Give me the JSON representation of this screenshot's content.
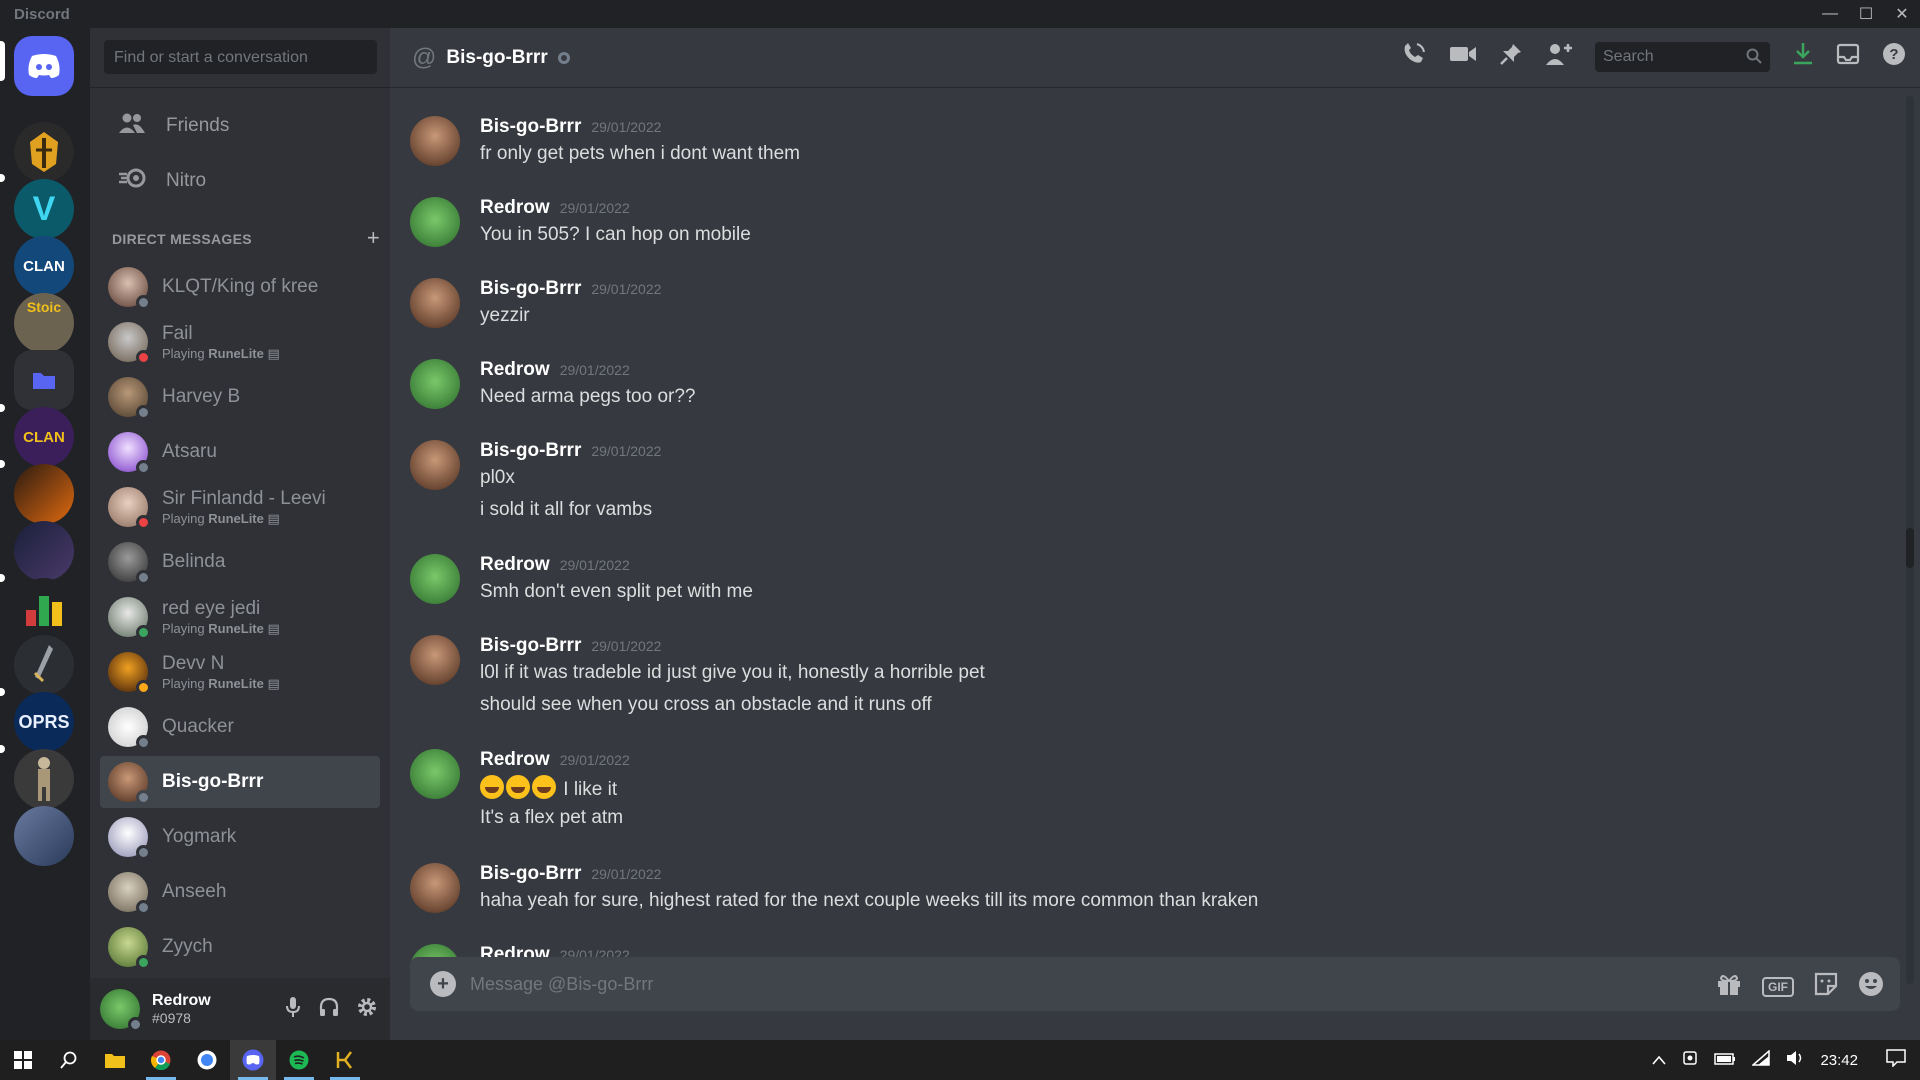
{
  "window": {
    "app_name": "Discord"
  },
  "colors": {
    "blurple": "#5865f2",
    "online": "#3ba55d",
    "dnd": "#ed4245",
    "idle": "#faa81a",
    "offline": "#747f8d"
  },
  "dm_sidebar": {
    "search_placeholder": "Find or start a conversation",
    "nav": {
      "friends": "Friends",
      "nitro": "Nitro"
    },
    "section_title": "DIRECT MESSAGES",
    "items": [
      {
        "name": "KLQT/King of kree",
        "sub": "",
        "status": "offline"
      },
      {
        "name": "Fail",
        "sub": "Playing ",
        "sub_game": "RuneLite",
        "status": "dnd"
      },
      {
        "name": "Harvey B",
        "sub": "",
        "status": "offline"
      },
      {
        "name": "Atsaru",
        "sub": "",
        "status": "offline"
      },
      {
        "name": "Sir Finlandd - Leevi",
        "sub": "Playing ",
        "sub_game": "RuneLite",
        "status": "dnd"
      },
      {
        "name": "Belinda",
        "sub": "",
        "status": "offline"
      },
      {
        "name": "red eye jedi",
        "sub": "Playing ",
        "sub_game": "RuneLite",
        "status": "online"
      },
      {
        "name": "Devv N",
        "sub": "Playing ",
        "sub_game": "RuneLite",
        "status": "idle"
      },
      {
        "name": "Quacker",
        "sub": "",
        "status": "offline"
      },
      {
        "name": "Bis-go-Brrr",
        "sub": "",
        "status": "offline"
      },
      {
        "name": "Yogmark",
        "sub": "",
        "status": "offline"
      },
      {
        "name": "Anseeh",
        "sub": "",
        "status": "offline"
      },
      {
        "name": "Zyych",
        "sub": "",
        "status": "online"
      }
    ]
  },
  "user_panel": {
    "username": "Redrow",
    "tag": "#0978"
  },
  "chat": {
    "title": "Bis-go-Brrr",
    "search_placeholder": "Search",
    "composer_placeholder": "Message @Bis-go-Brrr",
    "gif_label": "GIF",
    "messages": [
      {
        "author": "Bis-go-Brrr",
        "time": "29/01/2022",
        "lines": [
          "fr only get pets when i dont want them"
        ]
      },
      {
        "author": "Redrow",
        "time": "29/01/2022",
        "lines": [
          "You in 505? I can hop on mobile"
        ]
      },
      {
        "author": "Bis-go-Brrr",
        "time": "29/01/2022",
        "lines": [
          "yezzir"
        ]
      },
      {
        "author": "Redrow",
        "time": "29/01/2022",
        "lines": [
          "Need arma pegs too or??"
        ]
      },
      {
        "author": "Bis-go-Brrr",
        "time": "29/01/2022",
        "lines": [
          "pl0x",
          "i sold it all for vambs"
        ]
      },
      {
        "author": "Redrow",
        "time": "29/01/2022",
        "lines": [
          "Smh don't even split pet with me"
        ]
      },
      {
        "author": "Bis-go-Brrr",
        "time": "29/01/2022",
        "lines": [
          "l0l if it was tradeble id just give you it, honestly a horrible pet",
          "should see when you cross an obstacle and it runs off"
        ]
      },
      {
        "author": "Redrow",
        "time": "29/01/2022",
        "lines": [
          " I like it",
          "It's a flex pet atm"
        ]
      },
      {
        "author": "Bis-go-Brrr",
        "time": "29/01/2022",
        "lines": [
          "haha yeah for sure, highest rated for the next couple weeks till its more common than kraken"
        ]
      },
      {
        "author": "Redrow",
        "time": "29/01/2022",
        "lines": []
      }
    ]
  },
  "guilds": [
    {
      "label": "",
      "kind": "home"
    },
    {
      "label": "",
      "kind": "helmet"
    },
    {
      "label": "V",
      "kind": "v"
    },
    {
      "label": "CLAN",
      "kind": "clan"
    },
    {
      "label": "Stoic",
      "kind": "stoic"
    },
    {
      "label": "",
      "kind": "folder"
    },
    {
      "label": "CLAN",
      "kind": "clan2"
    },
    {
      "label": "",
      "kind": "fire"
    },
    {
      "label": "",
      "kind": "dark"
    },
    {
      "label": "",
      "kind": "chart"
    },
    {
      "label": "",
      "kind": "sword"
    },
    {
      "label": "OPRS",
      "kind": "oprs"
    },
    {
      "label": "",
      "kind": "warrior"
    },
    {
      "label": "",
      "kind": "anime"
    }
  ],
  "taskbar": {
    "clock": "23:42"
  }
}
